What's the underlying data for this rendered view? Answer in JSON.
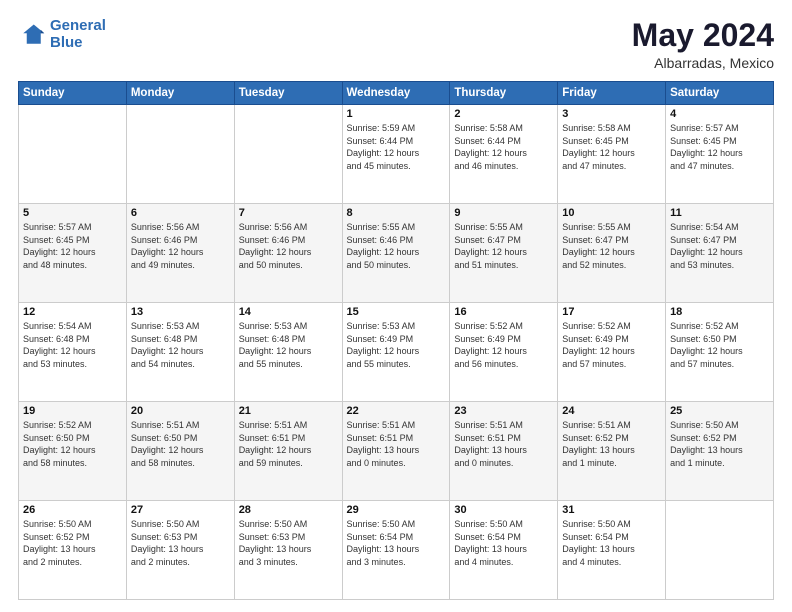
{
  "header": {
    "logo_line1": "General",
    "logo_line2": "Blue",
    "title": "May 2024",
    "subtitle": "Albarradas, Mexico"
  },
  "weekdays": [
    "Sunday",
    "Monday",
    "Tuesday",
    "Wednesday",
    "Thursday",
    "Friday",
    "Saturday"
  ],
  "weeks": [
    [
      {
        "day": "",
        "info": ""
      },
      {
        "day": "",
        "info": ""
      },
      {
        "day": "",
        "info": ""
      },
      {
        "day": "1",
        "info": "Sunrise: 5:59 AM\nSunset: 6:44 PM\nDaylight: 12 hours\nand 45 minutes."
      },
      {
        "day": "2",
        "info": "Sunrise: 5:58 AM\nSunset: 6:44 PM\nDaylight: 12 hours\nand 46 minutes."
      },
      {
        "day": "3",
        "info": "Sunrise: 5:58 AM\nSunset: 6:45 PM\nDaylight: 12 hours\nand 47 minutes."
      },
      {
        "day": "4",
        "info": "Sunrise: 5:57 AM\nSunset: 6:45 PM\nDaylight: 12 hours\nand 47 minutes."
      }
    ],
    [
      {
        "day": "5",
        "info": "Sunrise: 5:57 AM\nSunset: 6:45 PM\nDaylight: 12 hours\nand 48 minutes."
      },
      {
        "day": "6",
        "info": "Sunrise: 5:56 AM\nSunset: 6:46 PM\nDaylight: 12 hours\nand 49 minutes."
      },
      {
        "day": "7",
        "info": "Sunrise: 5:56 AM\nSunset: 6:46 PM\nDaylight: 12 hours\nand 50 minutes."
      },
      {
        "day": "8",
        "info": "Sunrise: 5:55 AM\nSunset: 6:46 PM\nDaylight: 12 hours\nand 50 minutes."
      },
      {
        "day": "9",
        "info": "Sunrise: 5:55 AM\nSunset: 6:47 PM\nDaylight: 12 hours\nand 51 minutes."
      },
      {
        "day": "10",
        "info": "Sunrise: 5:55 AM\nSunset: 6:47 PM\nDaylight: 12 hours\nand 52 minutes."
      },
      {
        "day": "11",
        "info": "Sunrise: 5:54 AM\nSunset: 6:47 PM\nDaylight: 12 hours\nand 53 minutes."
      }
    ],
    [
      {
        "day": "12",
        "info": "Sunrise: 5:54 AM\nSunset: 6:48 PM\nDaylight: 12 hours\nand 53 minutes."
      },
      {
        "day": "13",
        "info": "Sunrise: 5:53 AM\nSunset: 6:48 PM\nDaylight: 12 hours\nand 54 minutes."
      },
      {
        "day": "14",
        "info": "Sunrise: 5:53 AM\nSunset: 6:48 PM\nDaylight: 12 hours\nand 55 minutes."
      },
      {
        "day": "15",
        "info": "Sunrise: 5:53 AM\nSunset: 6:49 PM\nDaylight: 12 hours\nand 55 minutes."
      },
      {
        "day": "16",
        "info": "Sunrise: 5:52 AM\nSunset: 6:49 PM\nDaylight: 12 hours\nand 56 minutes."
      },
      {
        "day": "17",
        "info": "Sunrise: 5:52 AM\nSunset: 6:49 PM\nDaylight: 12 hours\nand 57 minutes."
      },
      {
        "day": "18",
        "info": "Sunrise: 5:52 AM\nSunset: 6:50 PM\nDaylight: 12 hours\nand 57 minutes."
      }
    ],
    [
      {
        "day": "19",
        "info": "Sunrise: 5:52 AM\nSunset: 6:50 PM\nDaylight: 12 hours\nand 58 minutes."
      },
      {
        "day": "20",
        "info": "Sunrise: 5:51 AM\nSunset: 6:50 PM\nDaylight: 12 hours\nand 58 minutes."
      },
      {
        "day": "21",
        "info": "Sunrise: 5:51 AM\nSunset: 6:51 PM\nDaylight: 12 hours\nand 59 minutes."
      },
      {
        "day": "22",
        "info": "Sunrise: 5:51 AM\nSunset: 6:51 PM\nDaylight: 13 hours\nand 0 minutes."
      },
      {
        "day": "23",
        "info": "Sunrise: 5:51 AM\nSunset: 6:51 PM\nDaylight: 13 hours\nand 0 minutes."
      },
      {
        "day": "24",
        "info": "Sunrise: 5:51 AM\nSunset: 6:52 PM\nDaylight: 13 hours\nand 1 minute."
      },
      {
        "day": "25",
        "info": "Sunrise: 5:50 AM\nSunset: 6:52 PM\nDaylight: 13 hours\nand 1 minute."
      }
    ],
    [
      {
        "day": "26",
        "info": "Sunrise: 5:50 AM\nSunset: 6:52 PM\nDaylight: 13 hours\nand 2 minutes."
      },
      {
        "day": "27",
        "info": "Sunrise: 5:50 AM\nSunset: 6:53 PM\nDaylight: 13 hours\nand 2 minutes."
      },
      {
        "day": "28",
        "info": "Sunrise: 5:50 AM\nSunset: 6:53 PM\nDaylight: 13 hours\nand 3 minutes."
      },
      {
        "day": "29",
        "info": "Sunrise: 5:50 AM\nSunset: 6:54 PM\nDaylight: 13 hours\nand 3 minutes."
      },
      {
        "day": "30",
        "info": "Sunrise: 5:50 AM\nSunset: 6:54 PM\nDaylight: 13 hours\nand 4 minutes."
      },
      {
        "day": "31",
        "info": "Sunrise: 5:50 AM\nSunset: 6:54 PM\nDaylight: 13 hours\nand 4 minutes."
      },
      {
        "day": "",
        "info": ""
      }
    ]
  ]
}
